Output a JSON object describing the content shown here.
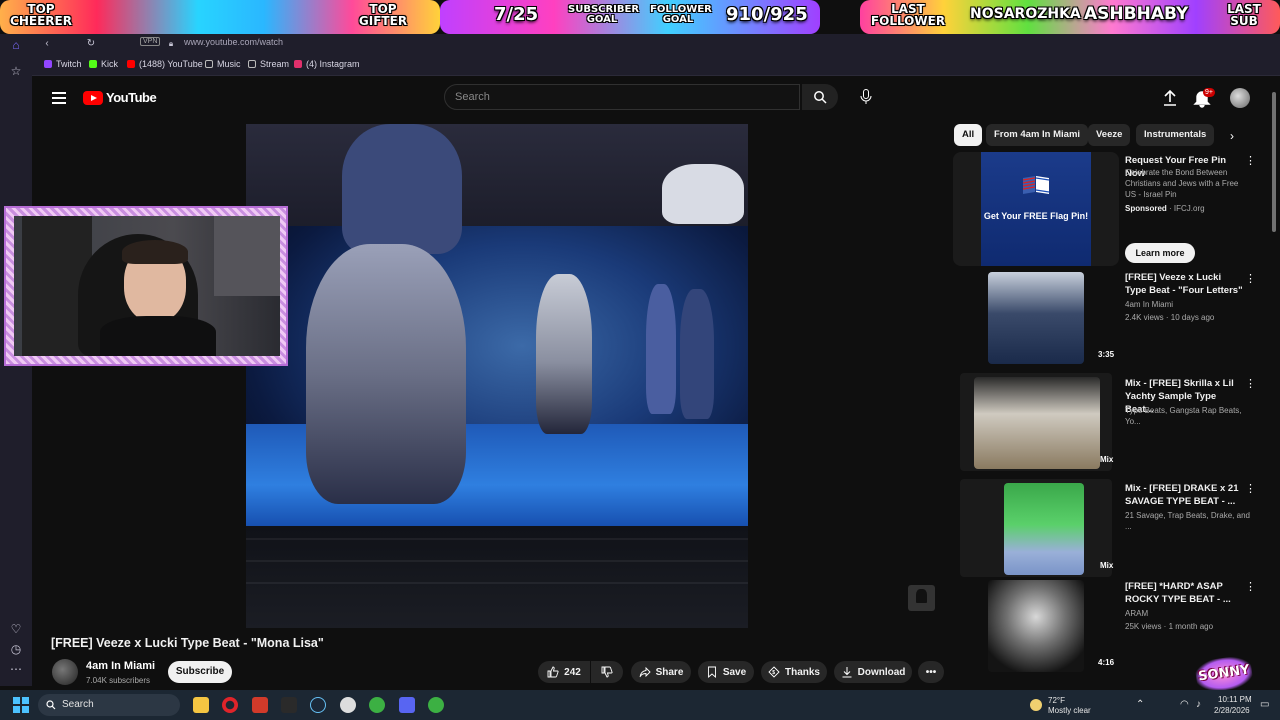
{
  "overlay": {
    "top_cheerer": "TOP CHEERER",
    "top_gifter": "TOP GIFTER",
    "sub_count": "7/25",
    "subscriber_goal": "SUBSCRIBER GOAL",
    "follower_goal": "FOLLOWER GOAL",
    "follower_count": "910/925",
    "last_follower": "LAST FOLLOWER",
    "last_follower_name": "NOSAROZHKA",
    "last_sub_name": "ASHBHABY",
    "last_sub": "LAST SUB",
    "watermark": "SONNY"
  },
  "browser": {
    "vpn": "VPN",
    "url": "www.youtube.com/watch",
    "bookmarks": [
      {
        "label": "Twitch",
        "color": "#9146ff"
      },
      {
        "label": "Kick",
        "color": "#53fc18"
      },
      {
        "label": "(1488) YouTube",
        "color": "#ff0000"
      },
      {
        "label": "Music",
        "color": "#bbbbbb"
      },
      {
        "label": "Stream",
        "color": "#bbbbbb"
      },
      {
        "label": "(4) Instagram",
        "color": "#e1306c"
      }
    ]
  },
  "header": {
    "logo_text": "YouTube",
    "search_placeholder": "Search",
    "notif_count": "9+"
  },
  "video": {
    "title": "[FREE] Veeze x Lucki Type Beat - \"Mona Lisa\"",
    "channel": "4am In Miami",
    "subscribers": "7.04K subscribers",
    "subscribe_label": "Subscribe",
    "likes": "242",
    "share_label": "Share",
    "save_label": "Save",
    "thanks_label": "Thanks",
    "download_label": "Download"
  },
  "chips": [
    "All",
    "From 4am In Miami",
    "Veeze",
    "Instrumentals"
  ],
  "ad": {
    "title": "Request Your Free Pin Now",
    "desc": "Celebrate the Bond Between Christians and Jews with a Free US - Israel Pin",
    "sponsored": "Sponsored",
    "domain": "· IFCJ.org",
    "image_text": "Get Your FREE Flag Pin!",
    "cta": "Learn more"
  },
  "related": [
    {
      "title": "[FREE] Veeze x Lucki Type Beat - \"Four Letters\"",
      "channel": "4am In Miami",
      "meta": "2.4K views · 10 days ago",
      "duration": "3:35"
    },
    {
      "title": "Mix - [FREE] Skrilla x Lil Yachty Sample Type Beat...",
      "channel": "Type Beats, Gangsta Rap Beats, Yo...",
      "meta": "",
      "duration": "Mix"
    },
    {
      "title": "Mix - [FREE] DRAKE x 21 SAVAGE TYPE BEAT - ...",
      "channel": "21 Savage, Trap Beats, Drake, and ...",
      "meta": "",
      "duration": "Mix"
    },
    {
      "title": "[FREE] *HARD* ASAP ROCKY TYPE BEAT - ...",
      "channel": "ARAM",
      "meta": "25K views · 1 month ago",
      "duration": "4:16"
    }
  ],
  "taskbar": {
    "search": "Search",
    "weather_temp": "72°F",
    "weather_desc": "Mostly clear",
    "time": "10:11 PM",
    "date": "2/28/2026"
  }
}
